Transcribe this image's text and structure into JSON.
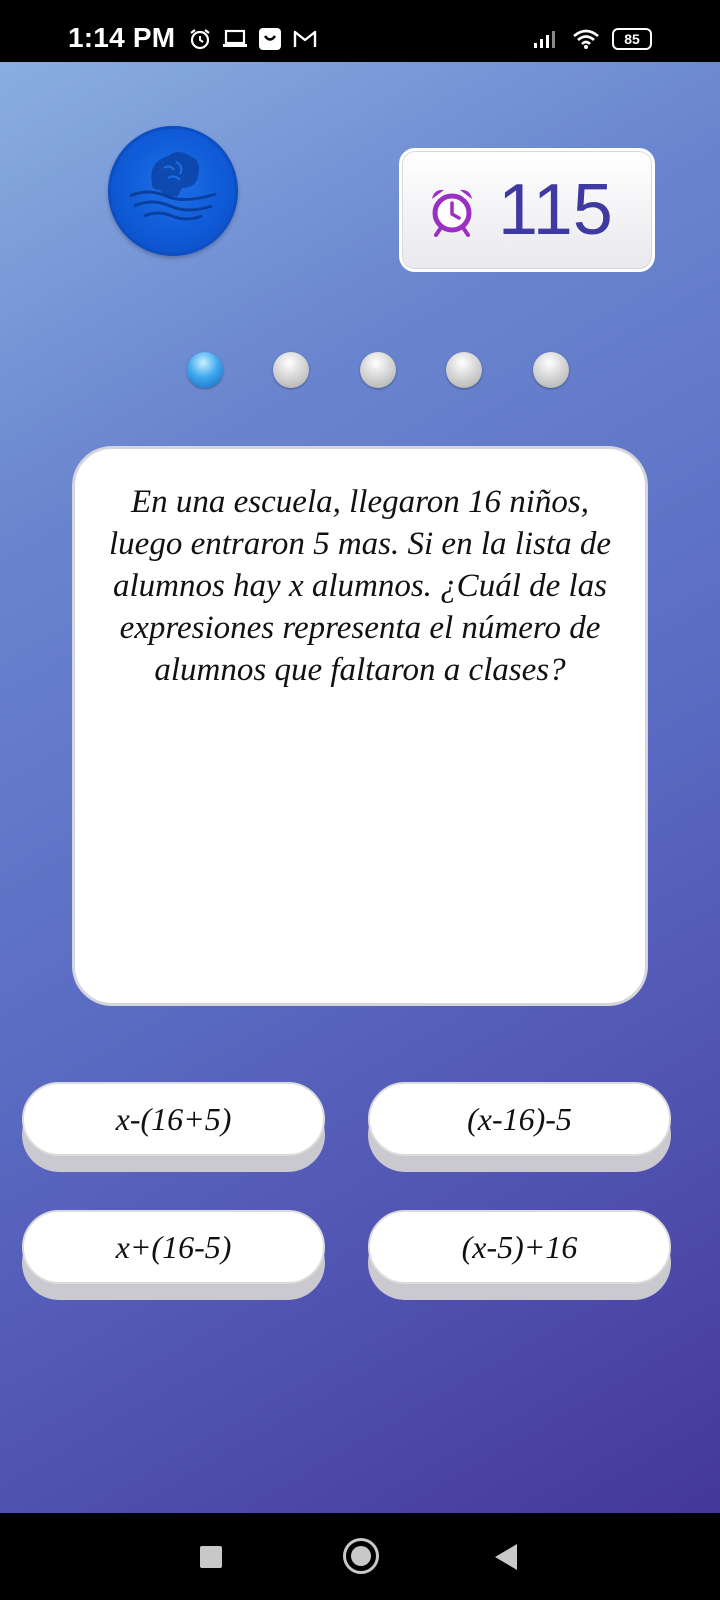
{
  "status_bar": {
    "time": "1:14 PM",
    "battery": "85",
    "left_icons": [
      "alarm-icon",
      "laptop-icon",
      "shopping-bag-icon",
      "gmail-icon"
    ],
    "right_icons": [
      "signal-icon",
      "wifi-icon",
      "battery-icon"
    ]
  },
  "header": {
    "logo_icon": "brain-waves-logo",
    "timer": {
      "icon": "alarm-clock-icon",
      "value": "115"
    }
  },
  "progress": {
    "total": 5,
    "current": 1
  },
  "question": {
    "text": "En una escuela, llegaron 16 niños, luego entraron 5 mas. Si en la lista de alumnos hay x alumnos. ¿Cuál de las expresiones representa el número de alumnos que faltaron a clases?"
  },
  "answers": [
    {
      "label": "x-(16+5)"
    },
    {
      "label": "(x-16)-5"
    },
    {
      "label": "x+(16-5)"
    },
    {
      "label": "(x-5)+16"
    }
  ],
  "nav_bar": {
    "icons": [
      "recents-square-icon",
      "home-circle-icon",
      "back-triangle-icon"
    ]
  },
  "colors": {
    "background_top": "#8aaee0",
    "background_bottom": "#44379b",
    "timer_text": "#3f3aa1",
    "timer_icon": "#9b2fc4",
    "logo": "#0f5ad7",
    "active_dot": "#3fa9ee"
  }
}
